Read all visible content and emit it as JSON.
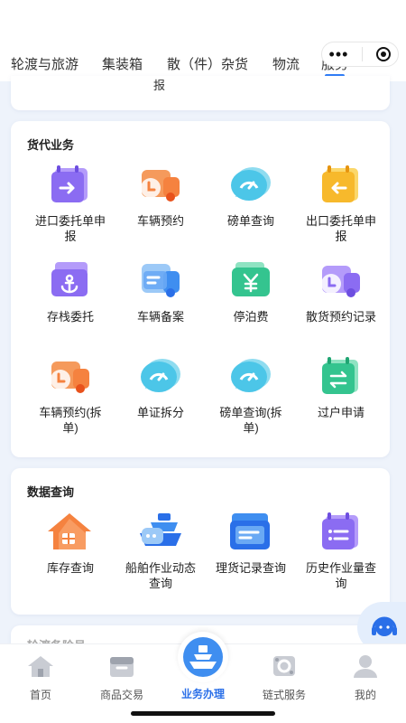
{
  "tabs": [
    {
      "label": "轮渡与旅游"
    },
    {
      "label": "集装箱"
    },
    {
      "label": "散（件）杂货"
    },
    {
      "label": "物流"
    },
    {
      "label": "服务"
    }
  ],
  "active_tab": "服务",
  "prev_card_fragment": "报",
  "cargo_section": {
    "title": "货代业务",
    "items": [
      {
        "label": "进口委托单申报",
        "icon": "calendar-arrow-right-icon"
      },
      {
        "label": "车辆预约",
        "icon": "truck-clock-icon"
      },
      {
        "label": "磅单查询",
        "icon": "gauge-bubble-icon"
      },
      {
        "label": "出口委托单申报",
        "icon": "calendar-arrow-left-icon"
      },
      {
        "label": "存栈委托",
        "icon": "anchor-box-icon"
      },
      {
        "label": "车辆备案",
        "icon": "truck-document-icon"
      },
      {
        "label": "停泊费",
        "icon": "yuan-wallet-icon"
      },
      {
        "label": "散货预约记录",
        "icon": "truck-clock-icon"
      },
      {
        "label": "车辆预约(拆单)",
        "icon": "truck-clock-icon"
      },
      {
        "label": "单证拆分",
        "icon": "gauge-bubble-icon"
      },
      {
        "label": "磅单查询(拆单)",
        "icon": "gauge-bubble-icon"
      },
      {
        "label": "过户申请",
        "icon": "calendar-transfer-icon"
      }
    ]
  },
  "data_section": {
    "title": "数据查询",
    "items": [
      {
        "label": "库存查询",
        "icon": "warehouse-icon"
      },
      {
        "label": "船舶作业动态查询",
        "icon": "ship-chat-icon"
      },
      {
        "label": "理货记录查询",
        "icon": "document-stack-icon"
      },
      {
        "label": "历史作业量查询",
        "icon": "calendar-list-icon"
      }
    ]
  },
  "next_section_title": "轮渡备险号",
  "bottom_nav": [
    {
      "label": "首页",
      "icon": "home-icon"
    },
    {
      "label": "商品交易",
      "icon": "shop-icon"
    },
    {
      "label": "业务办理",
      "icon": "ship-icon"
    },
    {
      "label": "链式服务",
      "icon": "chain-service-icon"
    },
    {
      "label": "我的",
      "icon": "user-icon"
    }
  ],
  "active_nav": "业务办理",
  "colors": {
    "accent": "#2f7cf6",
    "purple": "#8b6cf2",
    "orange": "#f5823f",
    "cyan": "#4cc6e8",
    "yellow": "#f7b92c",
    "green": "#34c48f"
  }
}
